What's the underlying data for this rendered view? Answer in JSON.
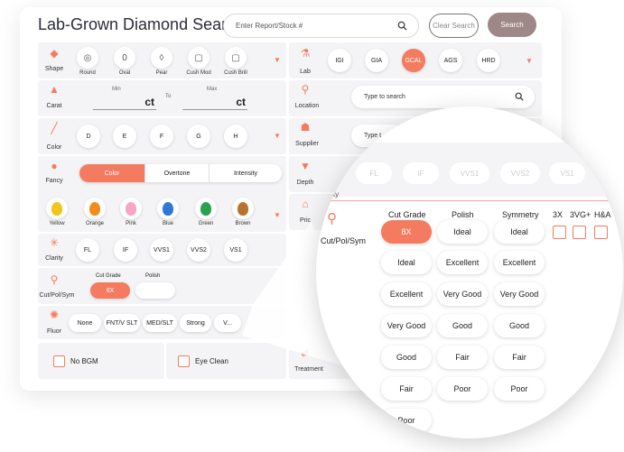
{
  "app": {
    "title": "Lab-Grown Diamond Search"
  },
  "search": {
    "placeholder": "Enter Report/Stock #",
    "clear_label": "Clear Search",
    "search_label": "Search"
  },
  "shape": {
    "label": "Shape",
    "items": [
      "Round",
      "Oval",
      "Pear",
      "Cush Mod",
      "Cush Brill"
    ]
  },
  "lab": {
    "label": "Lab",
    "items": [
      "IGI",
      "GIA",
      "GCAL",
      "AGS",
      "HRD"
    ],
    "selected": "GCAL"
  },
  "carat": {
    "label": "Carat",
    "min_label": "Min",
    "max_label": "Max",
    "to_label": "To",
    "unit": "ct"
  },
  "location": {
    "label": "Location",
    "placeholder": "Type to search"
  },
  "color": {
    "label": "Color",
    "items": [
      "D",
      "E",
      "F",
      "G",
      "H"
    ]
  },
  "supplier": {
    "label": "Supplier",
    "placeholder": "Type t"
  },
  "fancy": {
    "label": "Fancy",
    "tabs": [
      "Color",
      "Overtone",
      "Intensity"
    ],
    "selected": "Color",
    "gems": [
      {
        "name": "Yellow",
        "color": "#f3c419"
      },
      {
        "name": "Orange",
        "color": "#f48c1c"
      },
      {
        "name": "Pink",
        "color": "#f7a5c4"
      },
      {
        "name": "Blue",
        "color": "#2f78d6"
      },
      {
        "name": "Green",
        "color": "#27a350"
      },
      {
        "name": "Brown",
        "color": "#b8742f"
      }
    ]
  },
  "depth": {
    "label": "Depth"
  },
  "price": {
    "label": "Pric"
  },
  "clarity": {
    "label": "Clarity",
    "items": [
      "FL",
      "IF",
      "VVS1",
      "VVS2",
      "VS1"
    ]
  },
  "cutpolsym": {
    "label": "Cut/Pol/Sym",
    "cut_label": "Cut Grade",
    "polish_label": "Polish",
    "selected": "8X"
  },
  "fluor": {
    "label": "Fluor",
    "items": [
      "None",
      "FNT/V SLT",
      "MED/SLT",
      "Strong",
      "V..."
    ]
  },
  "bottom": {
    "no_bgm": "No BGM",
    "eye_clean": "Eye Clean",
    "treatment": "Treatment"
  },
  "lens": {
    "clarity_label": "arity",
    "faint_items": [
      "FL",
      "IF",
      "VVS1",
      "VVS2",
      "VS1"
    ],
    "row_label": "Cut/Pol/Sym",
    "headers": {
      "cut": "Cut Grade",
      "polish": "Polish",
      "symmetry": "Symmetry",
      "x3": "3X",
      "vg": "3VG+",
      "ha": "H&A"
    },
    "cut": [
      "8X",
      "Ideal",
      "Excellent",
      "Very Good",
      "Good",
      "Fair",
      "Poor"
    ],
    "polish": [
      "Ideal",
      "Excellent",
      "Very Good",
      "Good",
      "Fair",
      "Poor"
    ],
    "symmetry": [
      "Ideal",
      "Excellent",
      "Very Good",
      "Good",
      "Fair",
      "Poor"
    ]
  },
  "colors": {
    "accent": "#f47b5f",
    "search_button": "#9e8787"
  }
}
